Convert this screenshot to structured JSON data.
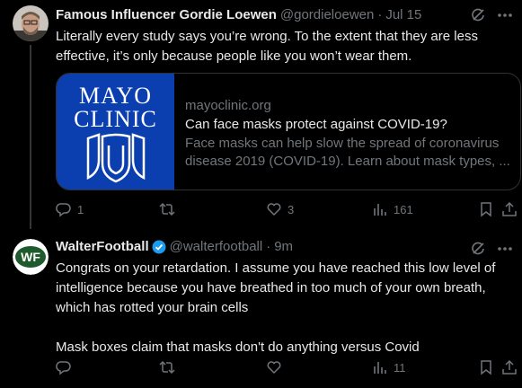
{
  "tweets": [
    {
      "name": "Famous Influencer Gordie Loewen",
      "handle": "@gordieloewen",
      "separator": "·",
      "time": "Jul 15",
      "text": "Literally every study says you’re wrong. To the extent that they are less effective, it’s only because people like you won’t wear them.",
      "card": {
        "logo_line1": "MAYO",
        "logo_line2": "CLINIC",
        "domain": "mayoclinic.org",
        "title": "Can face masks protect against COVID-19?",
        "description": "Face masks can help slow the spread of coronavirus disease 2019 (COVID-19). Learn about mask types, ..."
      },
      "actions": {
        "replies": "1",
        "reposts": "",
        "likes": "3",
        "views": "161"
      }
    },
    {
      "name": "WalterFootball",
      "avatar_text": "WF",
      "handle": "@walterfootball",
      "separator": "·",
      "time": "9m",
      "text": "Congrats on your retardation. I assume you have reached this low level of intelligence because you have breathed in too much of your own breath, which has rotted your brain cells\n\nMask boxes claim that masks don't do anything versus Covid",
      "actions": {
        "replies": "",
        "reposts": "",
        "likes": "",
        "views": "11"
      }
    }
  ],
  "colors": {
    "background": "#000000",
    "text": "#e7e9ea",
    "muted": "#71767b",
    "verified": "#1d9bf0",
    "mayo_blue": "#0b3fb0"
  },
  "icons": [
    "grok-icon",
    "more-icon",
    "reply-icon",
    "repost-icon",
    "like-icon",
    "views-icon",
    "bookmark-icon",
    "share-icon",
    "verified-badge-icon"
  ]
}
